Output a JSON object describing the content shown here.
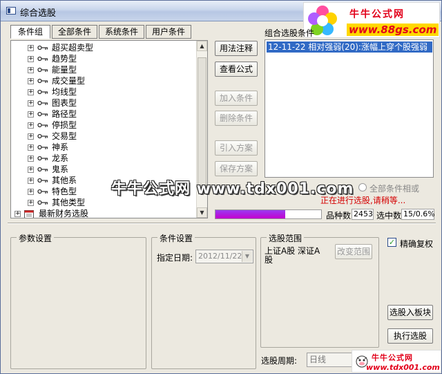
{
  "window": {
    "title": "综合选股"
  },
  "banner": {
    "brand": "牛牛公式网",
    "url": "www.88gs.com"
  },
  "tabs": [
    "条件组",
    "全部条件",
    "系统条件",
    "用户条件"
  ],
  "tree": {
    "items": [
      "超买超卖型",
      "趋势型",
      "能量型",
      "成交量型",
      "均线型",
      "图表型",
      "路径型",
      "停损型",
      "交易型",
      "神系",
      "龙系",
      "鬼系",
      "其他系",
      "特色型",
      "其他类型"
    ],
    "finance_item": "最新财务选股"
  },
  "middle_buttons": {
    "usage": "用法注释",
    "view": "查看公式",
    "add": "加入条件",
    "remove": "删除条件",
    "import": "引入方案",
    "save": "保存方案"
  },
  "combo": {
    "label": "组合选股条件",
    "items": [
      "12-11-22 相对强弱(20):涨幅上穿个股强弱"
    ]
  },
  "radios": {
    "or_label": "全部条件相或"
  },
  "status_text": "正在进行选股,请稍等...",
  "progress": {
    "fraction": 0.66
  },
  "stats": {
    "count_label": "品种数",
    "count_value": "2453",
    "selected_label": "选中数",
    "selected_value": "15/0.6%"
  },
  "groups": {
    "params": "参数设置",
    "conditions": "条件设置",
    "range": "选股范围"
  },
  "date": {
    "label": "指定日期:",
    "value": "2012/11/22"
  },
  "range": {
    "markets": "上证A股 深证A股",
    "change_button": "改变范围"
  },
  "options": {
    "exact_restore": "精确复权",
    "exact_checked": true
  },
  "right_buttons": {
    "to_block": "选股入板块",
    "execute": "执行选股"
  },
  "cycle": {
    "label": "选股周期:",
    "value": "日线"
  },
  "watermark": {
    "text": "牛牛公式网  www.tdx001.com"
  },
  "banner2": {
    "brand": "牛牛公式网",
    "url": "www.tdx001.com"
  }
}
